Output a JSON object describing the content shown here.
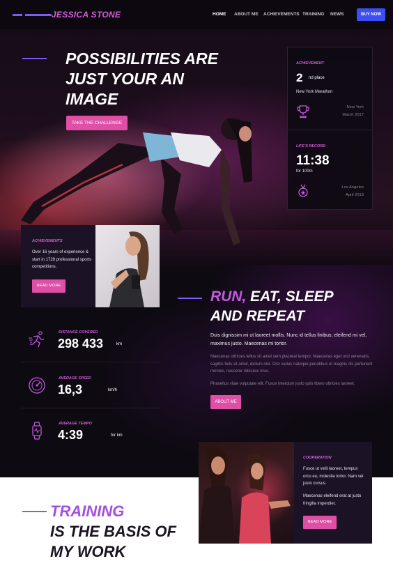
{
  "header": {
    "logo": "JESSICA STONE",
    "nav": [
      "HOME",
      "ABOUT ME",
      "ACHIEVEMENTS",
      "TRAINING",
      "NEWS"
    ],
    "buy_now": "BUY NOW"
  },
  "hero": {
    "title_lines": [
      "POSSIBILITIES ARE",
      "JUST YOUR AN",
      "IMAGE"
    ],
    "cta": "TAKE THE CHALLENGE"
  },
  "stats_panel": {
    "achievement": {
      "label": "ACHIEVEMENT",
      "value": "2",
      "suffix": "nd place",
      "event": "New York Marathon",
      "location": "New York",
      "date": "March 2017",
      "icon": "trophy-icon"
    },
    "record": {
      "label": "LIFE'S RECORD",
      "value": "11:38",
      "suffix": "for 100m",
      "location": "Los Angeles",
      "date": "April 2018",
      "icon": "medal-icon"
    }
  },
  "achievements_card": {
    "label": "ACHIEVEMENTS",
    "text": "Over 16 years of experience & start in 1729 professional sports competitions.",
    "button": "READ MORE"
  },
  "metrics": [
    {
      "label": "DISTANCE COVERED",
      "value": "298 433",
      "unit": "km",
      "icon": "runner-icon"
    },
    {
      "label": "AVERAGE SPEED",
      "value": "16,3",
      "unit": "km/h",
      "icon": "speedometer-icon"
    },
    {
      "label": "AVERAGE TEMPO",
      "value": "4:39",
      "unit": "for km",
      "icon": "smartwatch-icon"
    }
  ],
  "run_section": {
    "title_highlight": "RUN,",
    "title_rest_line1": " EAT, SLEEP",
    "title_line2": "AND REPEAT",
    "lead": "Duis dignissim mi ut laoreet mollis. Nunc id tellus finibus, eleifend mi vel, maximus justo. Maecenas mi tortor.",
    "body1": "Maecenas ultricies tellus sit amet sem placerat tempor. Maecenas eget orci venenatis, sagittis felis sit amet, dictum nisl. Orci varius natoque penatibus et magnis dis parturient montes, nascetur ridiculus mus.",
    "body2": "Phasellus vitae vulputate elit. Fusce interdum justo quis libero ultricies laoreet.",
    "button": "ABOUT ME"
  },
  "cooperation_card": {
    "label": "COOPERATION",
    "text1": "Fusce ut velit laoreet, tempus orcu eu, molestie tortor. Nam vel justo cursus.",
    "text2": "Maecenas eleifend erat at justo fringilla imperdiet.",
    "button": "READ MORE"
  },
  "training": {
    "title_highlight": "TRAINING",
    "title_line2": "IS THE BASIS OF",
    "title_line3": "MY WORK"
  },
  "colors": {
    "accent_pink": "#e04fa6",
    "accent_purple": "#d25fd8",
    "button_blue": "#3b4ff2",
    "line_violet": "#7b5cf0"
  }
}
